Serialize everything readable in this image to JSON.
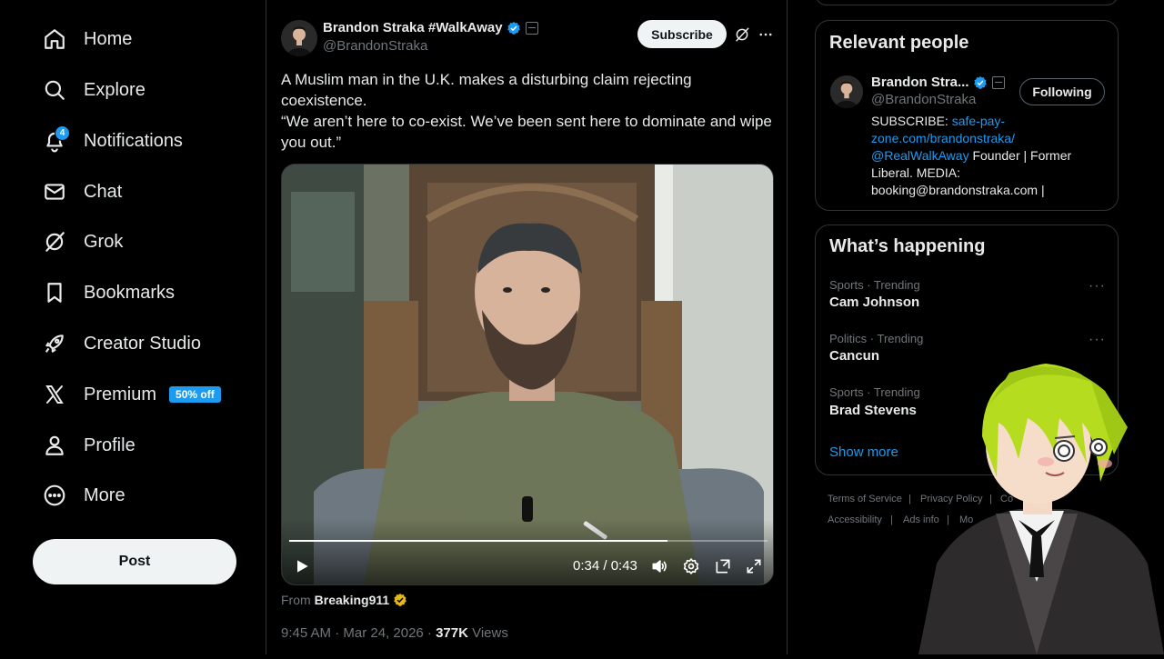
{
  "nav": {
    "items": [
      {
        "label": "Home",
        "icon": "home-icon"
      },
      {
        "label": "Explore",
        "icon": "search-icon"
      },
      {
        "label": "Notifications",
        "icon": "bell-icon",
        "badge": "4"
      },
      {
        "label": "Chat",
        "icon": "mail-icon"
      },
      {
        "label": "Grok",
        "icon": "grok-icon"
      },
      {
        "label": "Bookmarks",
        "icon": "bookmark-icon"
      },
      {
        "label": "Creator Studio",
        "icon": "rocket-icon"
      },
      {
        "label": "Premium",
        "icon": "x-logo-icon",
        "badge": "50% off"
      },
      {
        "label": "Profile",
        "icon": "person-icon"
      },
      {
        "label": "More",
        "icon": "more-circle-icon"
      }
    ],
    "post_label": "Post"
  },
  "tweet": {
    "author_name": "Brandon Straka #WalkAway",
    "author_handle": "@BrandonStraka",
    "subscribe_label": "Subscribe",
    "text_line1": "A Muslim man in the U.K. makes a disturbing claim rejecting coexistence.",
    "text_line2": "“We aren’t here to co-exist. We’ve been sent here to dominate and wipe you out.”",
    "video": {
      "time": "0:34 / 0:43",
      "progress_fraction": 0.79
    },
    "from_label": "From",
    "from_source": "Breaking911",
    "timestamp": "9:45 AM · Mar 24, 2026 · ",
    "views_count": "377K",
    "views_label": " Views"
  },
  "sidebar": {
    "relevant_people": {
      "title": "Relevant people",
      "name": "Brandon Stra...",
      "handle": "@BrandonStraka",
      "follow_label": "Following",
      "bio_prefix": "SUBSCRIBE: ",
      "bio_link1": "safe-pay-zone.com/brandonstraka/",
      "bio_link2": "@RealWalkAway",
      "bio_rest": " Founder | Former Liberal. MEDIA: booking@brandonstraka.com |"
    },
    "whats_happening": {
      "title": "What’s happening",
      "trends": [
        {
          "category": "Sports · Trending",
          "name": "Cam Johnson"
        },
        {
          "category": "Politics · Trending",
          "name": "Cancun"
        },
        {
          "category": "Sports · Trending",
          "name": "Brad Stevens"
        }
      ],
      "show_more": "Show more"
    },
    "footer": {
      "links": [
        "Terms of Service",
        "Privacy Policy",
        "Co",
        "Accessibility",
        "Ads info",
        "Mo"
      ]
    }
  },
  "colors": {
    "accent": "#1d9bf0",
    "background": "#000000",
    "text": "#e7e9ea",
    "muted": "#71767b",
    "border": "#2f3336"
  }
}
